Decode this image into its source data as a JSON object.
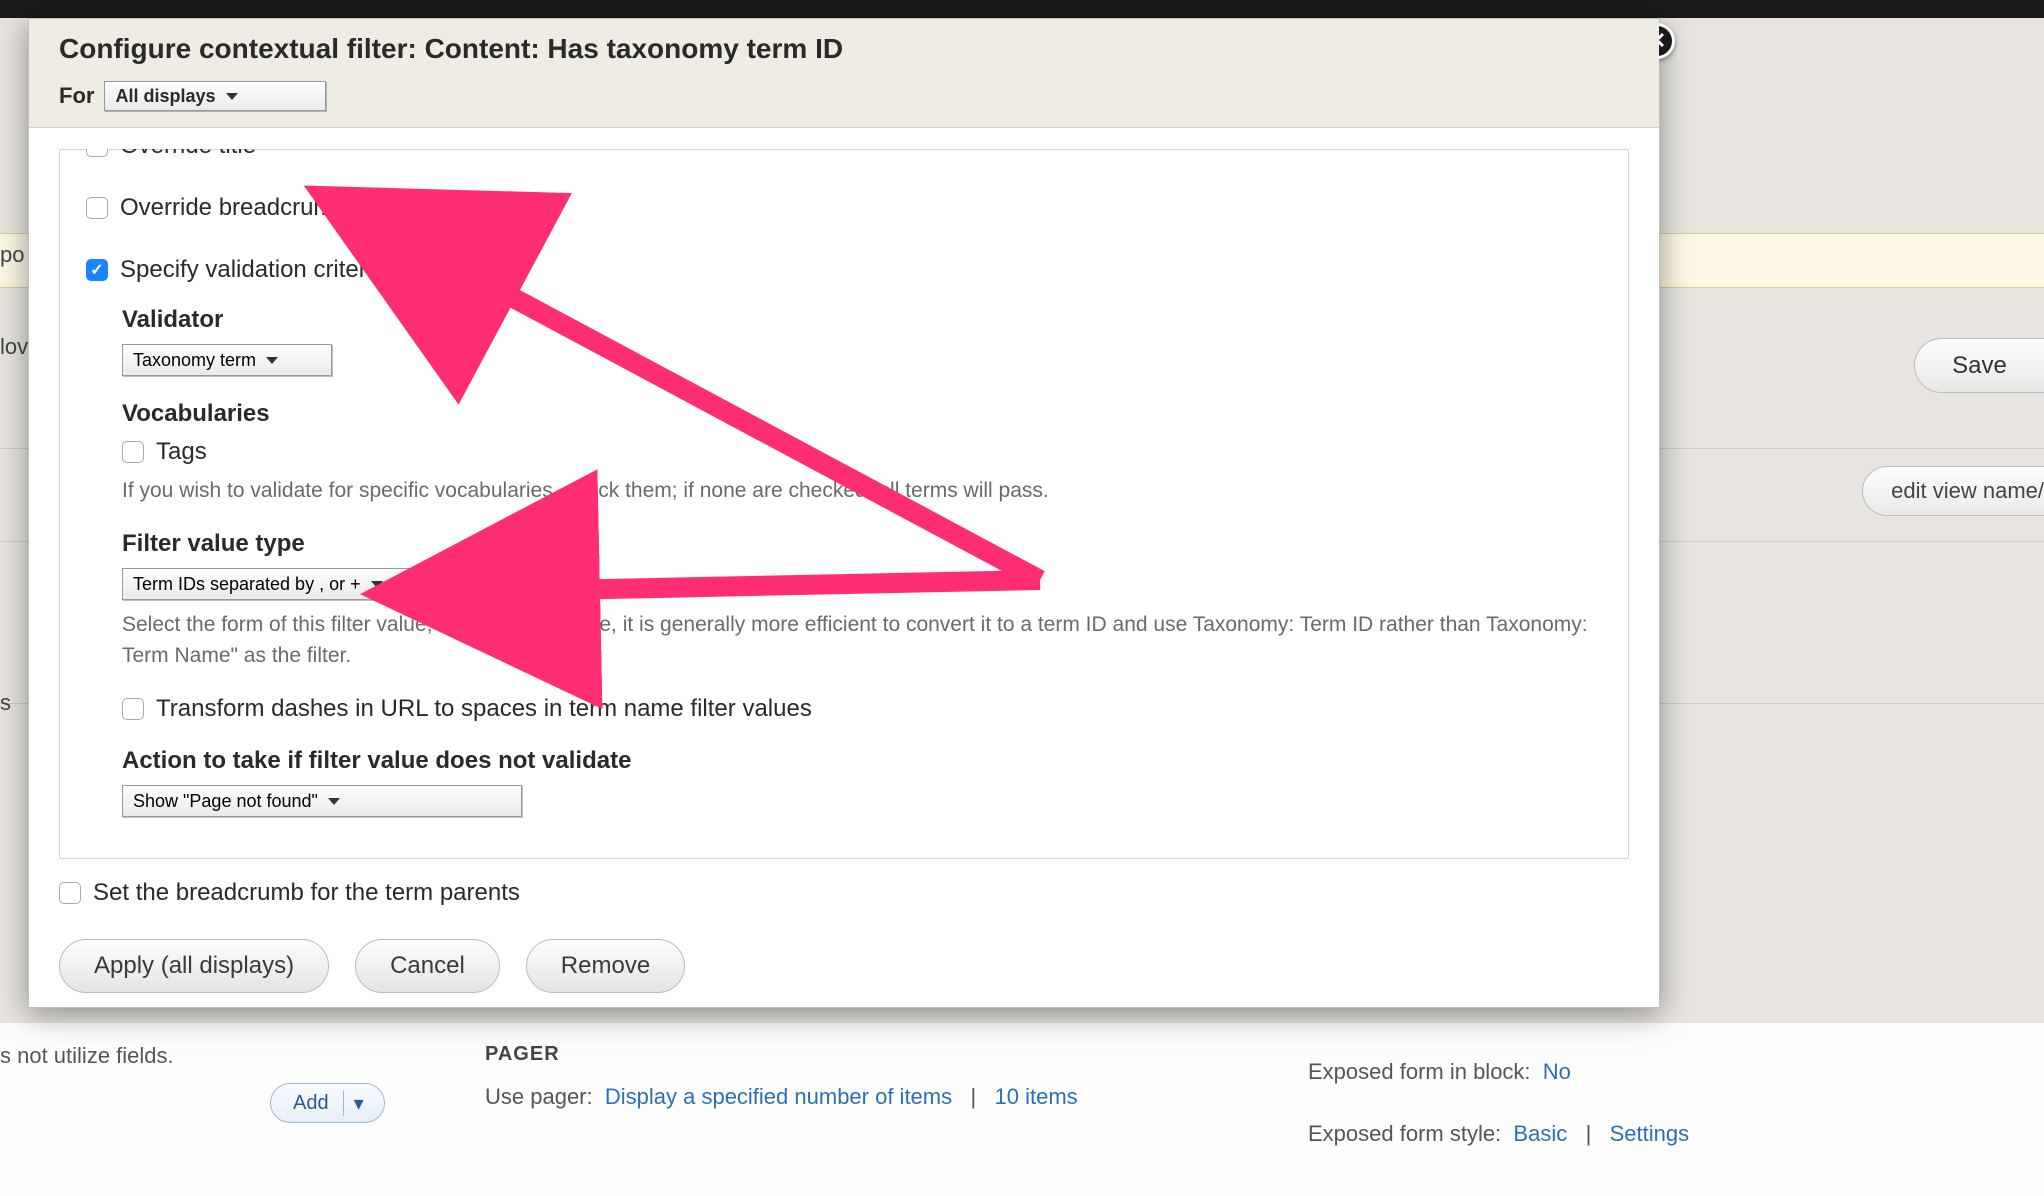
{
  "modal": {
    "title": "Configure contextual filter: Content: Has taxonomy term ID",
    "for_label": "For",
    "for_value": "All displays",
    "options": {
      "override_title": "Override title",
      "override_breadcrumb": "Override breadcrumb",
      "specify_validation": "Specify validation criteria"
    },
    "validator": {
      "label": "Validator",
      "value": "Taxonomy term"
    },
    "vocabularies": {
      "label": "Vocabularies",
      "tags": "Tags",
      "help": "If you wish to validate for specific vocabularies, check them; if none are checked, all terms will pass."
    },
    "filter_value": {
      "label": "Filter value type",
      "value": "Term IDs separated by , or +",
      "help": "Select the form of this filter value; if using term name, it is generally more efficient to convert it to a term ID and use Taxonomy: Term ID rather than Taxonomy: Term Name\" as the filter."
    },
    "transform_dashes": "Transform dashes in URL to spaces in term name filter values",
    "action": {
      "label": "Action to take if filter value does not validate",
      "value": "Show \"Page not found\""
    },
    "set_breadcrumb": "Set the breadcrumb for the term parents",
    "buttons": {
      "apply": "Apply (all displays)",
      "cancel": "Cancel",
      "remove": "Remove"
    }
  },
  "bg": {
    "po": "po",
    "lov": "lov",
    "s": "s",
    "save": "Save",
    "edit_view": "edit view name/",
    "fields_not": "s not utilize fields.",
    "add": "Add",
    "pager_heading": "PAGER",
    "use_pager_label": "Use pager:",
    "use_pager_link1": "Display a specified number of items",
    "use_pager_sep": "|",
    "use_pager_link2": "10 items",
    "exposed_block_label": "Exposed form in block:",
    "exposed_block_val": "No",
    "exposed_style_label": "Exposed form style:",
    "exposed_style_val1": "Basic",
    "exposed_style_val2": "Settings"
  }
}
